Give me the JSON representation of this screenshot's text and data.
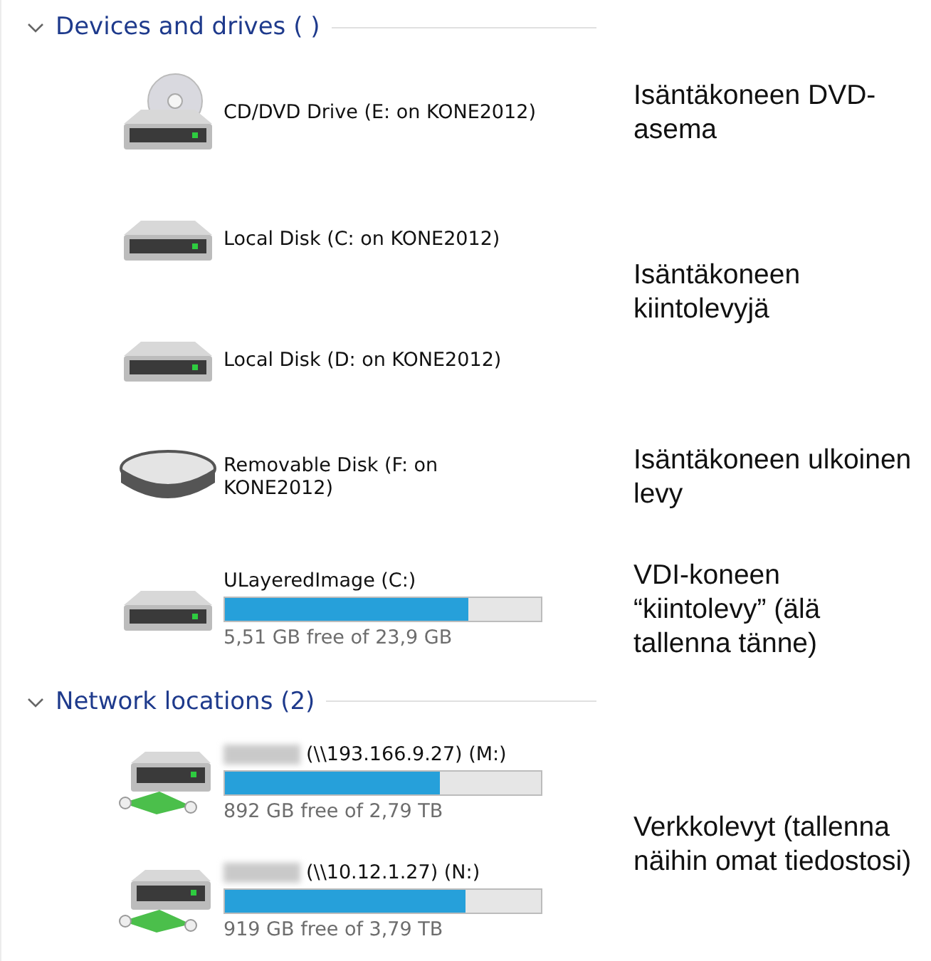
{
  "sections": [
    {
      "title": "Devices and drives ( )",
      "expanded": true,
      "items": [
        {
          "kind": "dvd",
          "name": "CD/DVD Drive (E: on KONE2012)"
        },
        {
          "kind": "disk",
          "name": "Local Disk (C: on KONE2012)"
        },
        {
          "kind": "disk",
          "name": "Local Disk (D: on KONE2012)"
        },
        {
          "kind": "removable",
          "name": "Removable Disk (F: on KONE2012)"
        },
        {
          "kind": "disk",
          "name": "ULayeredImage (C:)",
          "level": 0.77,
          "space": "5,51 GB free of 23,9 GB"
        }
      ]
    },
    {
      "title": "Network locations (2)",
      "expanded": true,
      "items": [
        {
          "kind": "network",
          "redacted": true,
          "name": "(\\\\193.166.9.27) (M:)",
          "level": 0.68,
          "space": "892 GB free of 2,79 TB"
        },
        {
          "kind": "network",
          "redacted": true,
          "name": "(\\\\10.12.1.27) (N:)",
          "level": 0.76,
          "space": "919 GB free of 3,79 TB"
        }
      ]
    }
  ],
  "annotations": [
    {
      "text": "Isäntäkoneen DVD-asema"
    },
    {
      "text": "Isäntäkoneen kiintolevyjä"
    },
    {
      "text": "Isäntäkoneen ulkoinen levy"
    },
    {
      "text": "VDI-koneen “kiintolevy” (älä tallenna tänne)"
    },
    {
      "text": "Verkkolevyt (tallenna näihin omat tiedostosi)"
    }
  ]
}
